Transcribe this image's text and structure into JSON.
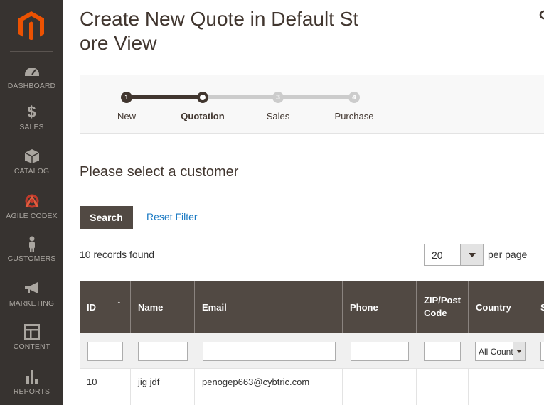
{
  "sidebar": {
    "items": [
      {
        "label": "DASHBOARD",
        "icon": "dashboard-icon"
      },
      {
        "label": "SALES",
        "icon": "dollar-icon"
      },
      {
        "label": "CATALOG",
        "icon": "box-icon"
      },
      {
        "label": "AGILE CODEX",
        "icon": "agile-codex-icon"
      },
      {
        "label": "CUSTOMERS",
        "icon": "person-icon"
      },
      {
        "label": "MARKETING",
        "icon": "megaphone-icon"
      },
      {
        "label": "CONTENT",
        "icon": "layout-icon"
      },
      {
        "label": "REPORTS",
        "icon": "bar-chart-icon"
      }
    ],
    "colors": {
      "bg": "#373330",
      "text": "#aaa6a0",
      "logo": "#eb5202"
    }
  },
  "page": {
    "title_line1": "Create New Quote in Default St",
    "title_line2": "ore View"
  },
  "steps": [
    {
      "num": "1",
      "label": "New",
      "state": "complete"
    },
    {
      "num": "",
      "label": "Quotation",
      "state": "active"
    },
    {
      "num": "3",
      "label": "Sales",
      "state": "pending"
    },
    {
      "num": "4",
      "label": "Purchase",
      "state": "pending"
    }
  ],
  "section": {
    "title": "Please select a customer"
  },
  "actions": {
    "search": "Search",
    "reset": "Reset Filter"
  },
  "records": {
    "found": "10 records found",
    "per_page_value": "20",
    "per_page_label": "per page"
  },
  "grid": {
    "columns": [
      {
        "label": "ID",
        "sort": "↑"
      },
      {
        "label": "Name"
      },
      {
        "label": "Email"
      },
      {
        "label": "Phone"
      },
      {
        "label": "ZIP/Post Code"
      },
      {
        "label": "Country"
      },
      {
        "label": "S"
      }
    ],
    "country_filter": "All Countries",
    "rows": [
      {
        "id": "10",
        "name": "jig jdf",
        "email": "penogep663@cybtric.com",
        "phone": "",
        "zip": "",
        "country": ""
      }
    ]
  }
}
